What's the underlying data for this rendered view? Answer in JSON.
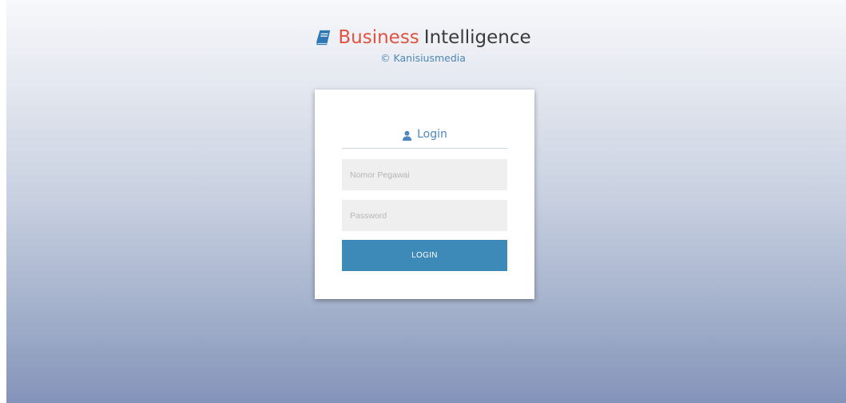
{
  "brand": {
    "icon": "book-icon",
    "title_accent": "Business",
    "title_rest": "Intelligence",
    "copyright": "© Kanisiusmedia",
    "accent_color": "#e0533f",
    "link_color": "#4e86b5"
  },
  "login_card": {
    "header_icon": "user-icon",
    "header_label": "Login",
    "username_placeholder": "Nomor Pegawai",
    "username_value": "",
    "password_placeholder": "Password",
    "password_value": "",
    "submit_label": "LOGIN",
    "button_color": "#3d8ab9"
  }
}
